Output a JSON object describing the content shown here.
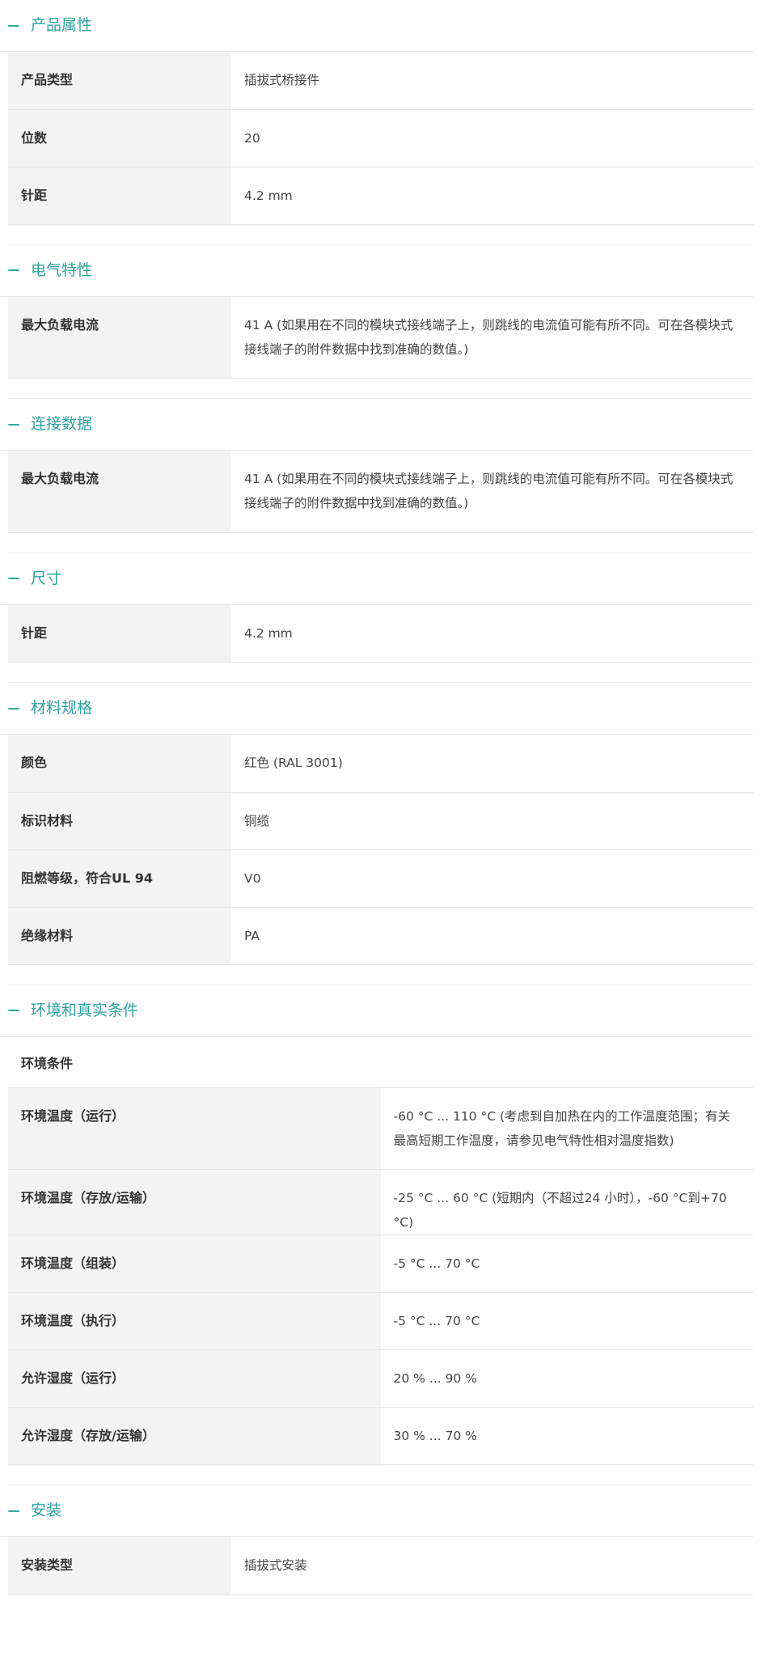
{
  "sections": [
    {
      "title": "产品属性",
      "rows": [
        {
          "label": "产品类型",
          "value": "插拔式桥接件"
        },
        {
          "label": "位数",
          "value": "20"
        },
        {
          "label": "针距",
          "value": "4.2 mm"
        }
      ]
    },
    {
      "title": "电气特性",
      "rows": [
        {
          "label": "最大负载电流",
          "value": "41 A (如果用在不同的模块式接线端子上，则跳线的电流值可能有所不同。可在各模块式接线端子的附件数据中找到准确的数值。)"
        }
      ]
    },
    {
      "title": "连接数据",
      "rows": [
        {
          "label": "最大负载电流",
          "value": "41 A (如果用在不同的模块式接线端子上，则跳线的电流值可能有所不同。可在各模块式接线端子的附件数据中找到准确的数值。)"
        }
      ]
    },
    {
      "title": "尺寸",
      "rows": [
        {
          "label": "针距",
          "value": "4.2 mm"
        }
      ]
    },
    {
      "title": "材料规格",
      "rows": [
        {
          "label": "颜色",
          "value": "红色 (RAL 3001)"
        },
        {
          "label": "标识材料",
          "value": "铜缆"
        },
        {
          "label": "阻燃等级，符合UL 94",
          "value": "V0"
        },
        {
          "label": "绝缘材料",
          "value": "PA"
        }
      ]
    },
    {
      "title": "环境和真实条件",
      "subheading": "环境条件",
      "rows": [
        {
          "label": "环境温度（运行）",
          "value": "-60 °C ... 110 °C (考虑到自加热在内的工作温度范围；有关最高短期工作温度，请参见电气特性相对温度指数)"
        },
        {
          "label": "环境温度（存放/运输）",
          "value": "-25 °C ... 60 °C (短期内（不超过24 小时），-60 °C到+70 °C)"
        },
        {
          "label": "环境温度（组装）",
          "value": "-5 °C ... 70 °C"
        },
        {
          "label": "环境温度（执行）",
          "value": "-5 °C ... 70 °C"
        },
        {
          "label": "允许湿度（运行）",
          "value": "20 % ... 90 %"
        },
        {
          "label": "允许湿度（存放/运输）",
          "value": "30 % ... 70 %"
        }
      ]
    },
    {
      "title": "安装",
      "rows": [
        {
          "label": "安装类型",
          "value": "插拔式安装"
        }
      ]
    }
  ],
  "colors": {
    "accent": "#2ea3a0",
    "label_bg": "#f3f3f3",
    "border": "#e3e3e3"
  }
}
